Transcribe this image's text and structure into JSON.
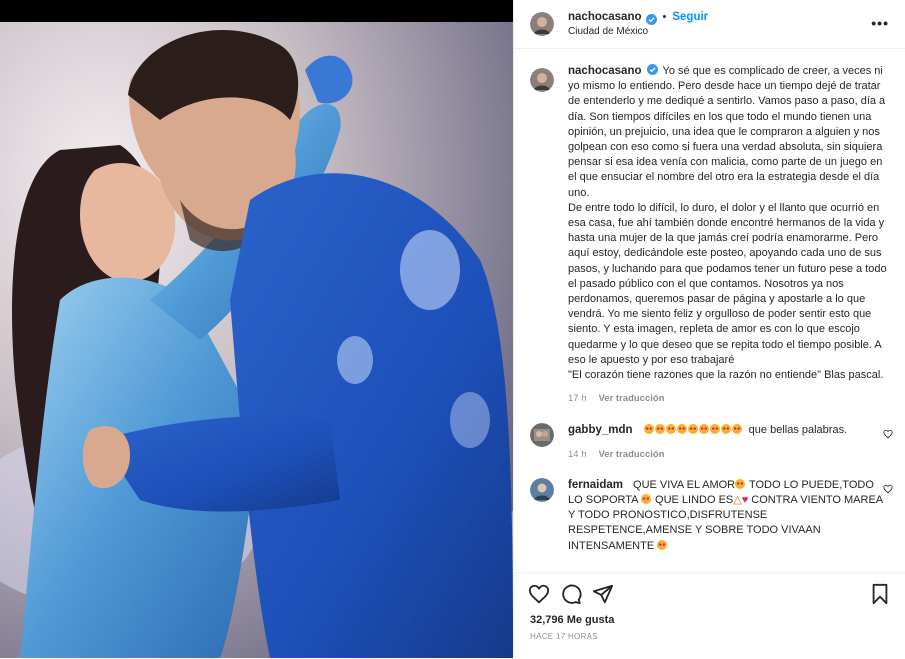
{
  "post": {
    "author": "nachocasano",
    "location": "Ciudad de México",
    "follow_label": "Seguir",
    "separator": "•",
    "more_label": "•••"
  },
  "caption": {
    "author": "nachocasano",
    "paragraphs": [
      "Yo sé que es complicado de creer, a veces ni yo mismo lo entiendo. Pero desde hace un tiempo dejé de tratar de entenderlo y me dediqué a sentirlo. Vamos paso a paso, día a día. Son tiempos difíciles en los que todo el mundo tienen una opinión, un prejuicio, una idea que le compraron a alguien y nos golpean con eso como si fuera una verdad absoluta, sin siquiera pensar si esa idea venía con malicia, como parte de un juego en el que ensuciar el nombre del otro era la estrategia desde el día uno.",
      "De entre todo lo difícil, lo duro, el dolor y el llanto que ocurrió en esa casa, fue ahí también donde encontré hermanos de la vida y hasta una mujer de la que jamás creí podría enamorarme. Pero aquí estoy, dedicándole este posteo, apoyando cada uno de sus pasos, y luchando para que podamos tener un futuro pese a todo el pasado público con el que contamos. Nosotros ya nos perdonamos, queremos pasar de página y apostarle a lo que vendrá. Yo me siento feliz y orgulloso de poder sentir esto que siento. Y esta imagen, repleta de amor es con lo que escojo quedarme y lo que deseo que se repita todo el tiempo posible. A eso le apuesto y por eso trabajaré",
      "\"El corazón tiene razones que la razón no entiende\" Blas pascal."
    ],
    "time": "17 h",
    "translate_label": "Ver traducción"
  },
  "comments": [
    {
      "author": "gabby_mdn",
      "emoji_count": 9,
      "text": "que bellas palabras.",
      "time": "14 h",
      "translate_label": "Ver traducción"
    },
    {
      "author": "fernaidam",
      "text_parts": [
        "QUE VIVA EL AMOR",
        " TODO LO PUEDE,TODO LO SOPORTA ",
        " QUE LINDO ES",
        " CONTRA VIENTO MAREA Y TODO PRONOSTICO,DISFRUTENSE RESPETENCE,AMENSE Y SOBRE TODO VIVAAN INTENSAMENTE "
      ]
    }
  ],
  "actions": {
    "likes": "32,796 Me gusta",
    "age": "HACE 17 HORAS",
    "icons": [
      "heart-icon",
      "comment-icon",
      "share-icon",
      "bookmark-icon"
    ]
  },
  "colors": {
    "link": "#0095f6",
    "muted": "#8e8e8e",
    "text": "#262626",
    "suit": "#1d4fb8"
  }
}
